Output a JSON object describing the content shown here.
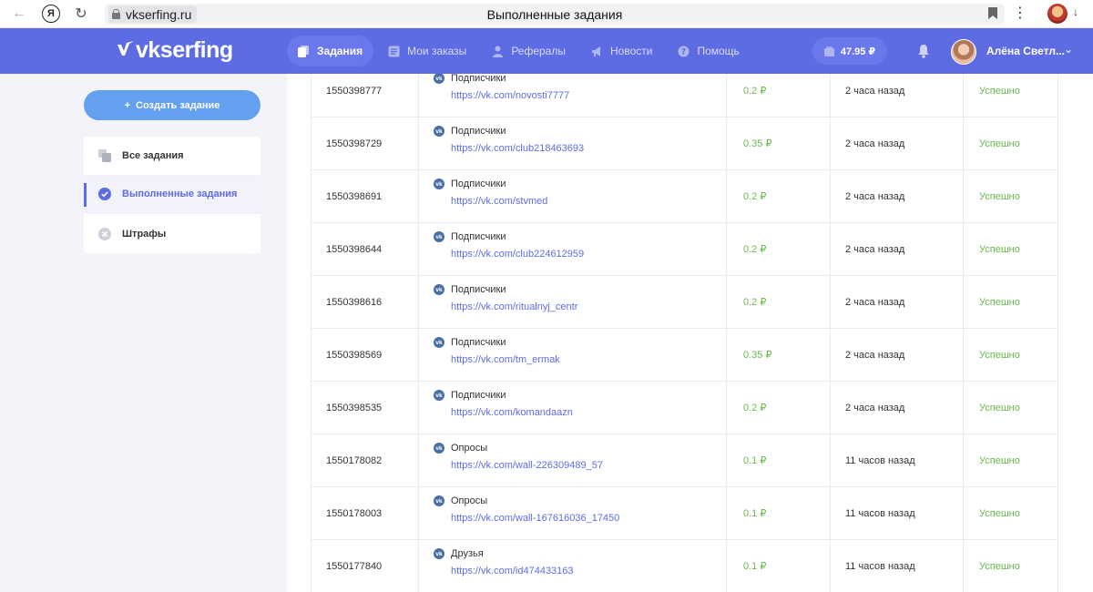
{
  "browser": {
    "domain": "vkserfing.ru",
    "page_title": "Выполненные задания"
  },
  "header": {
    "logo_text": "vkserfing",
    "nav": [
      {
        "label": "Задания",
        "icon": "tasks-icon",
        "active": true
      },
      {
        "label": "Мои заказы",
        "icon": "orders-icon",
        "active": false
      },
      {
        "label": "Рефералы",
        "icon": "referrals-icon",
        "active": false
      },
      {
        "label": "Новости",
        "icon": "megaphone-icon",
        "active": false
      },
      {
        "label": "Помощь",
        "icon": "help-icon",
        "active": false
      }
    ],
    "balance": "47.95 ₽",
    "user_name": "Алёна Светл..."
  },
  "sidebar": {
    "create_button": "Создать задание",
    "items": [
      {
        "label": "Все задания",
        "icon": "copy-icon",
        "active": false
      },
      {
        "label": "Выполненные задания",
        "icon": "check-circle-icon",
        "active": true
      },
      {
        "label": "Штрафы",
        "icon": "x-circle-icon",
        "active": false
      }
    ]
  },
  "table": {
    "rows": [
      {
        "id": "1550398777",
        "type": "Подписчики",
        "link": "https://vk.com/novosti7777",
        "price": "0.2 ₽",
        "time": "2 часа назад",
        "status": "Успешно"
      },
      {
        "id": "1550398729",
        "type": "Подписчики",
        "link": "https://vk.com/club218463693",
        "price": "0.35 ₽",
        "time": "2 часа назад",
        "status": "Успешно"
      },
      {
        "id": "1550398691",
        "type": "Подписчики",
        "link": "https://vk.com/stvmed",
        "price": "0.2 ₽",
        "time": "2 часа назад",
        "status": "Успешно"
      },
      {
        "id": "1550398644",
        "type": "Подписчики",
        "link": "https://vk.com/club224612959",
        "price": "0.2 ₽",
        "time": "2 часа назад",
        "status": "Успешно"
      },
      {
        "id": "1550398616",
        "type": "Подписчики",
        "link": "https://vk.com/ritualnyj_centr",
        "price": "0.2 ₽",
        "time": "2 часа назад",
        "status": "Успешно"
      },
      {
        "id": "1550398569",
        "type": "Подписчики",
        "link": "https://vk.com/tm_ermak",
        "price": "0.35 ₽",
        "time": "2 часа назад",
        "status": "Успешно"
      },
      {
        "id": "1550398535",
        "type": "Подписчики",
        "link": "https://vk.com/komandaazn",
        "price": "0.2 ₽",
        "time": "2 часа назад",
        "status": "Успешно"
      },
      {
        "id": "1550178082",
        "type": "Опросы",
        "link": "https://vk.com/wall-226309489_57",
        "price": "0.1 ₽",
        "time": "11 часов назад",
        "status": "Успешно"
      },
      {
        "id": "1550178003",
        "type": "Опросы",
        "link": "https://vk.com/wall-167616036_17450",
        "price": "0.1 ₽",
        "time": "11 часов назад",
        "status": "Успешно"
      },
      {
        "id": "1550177840",
        "type": "Друзья",
        "link": "https://vk.com/id474433163",
        "price": "0.1 ₽",
        "time": "11 часов назад",
        "status": "Успешно"
      }
    ]
  },
  "colors": {
    "brand": "#5e6ce3",
    "create_button": "#64a0f0",
    "success": "#67b84c",
    "vk_badge": "#4a6fa5"
  }
}
